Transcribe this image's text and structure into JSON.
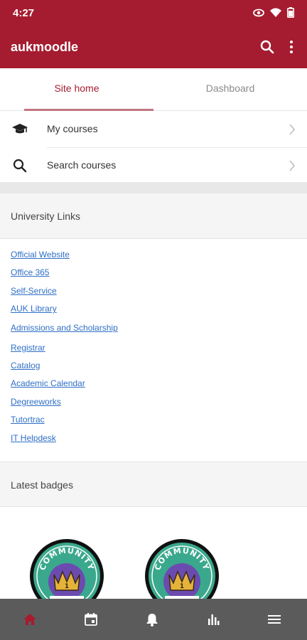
{
  "status": {
    "time": "4:27"
  },
  "app": {
    "title": "aukmoodle"
  },
  "tabs": [
    {
      "label": "Site home",
      "active": true
    },
    {
      "label": "Dashboard",
      "active": false
    }
  ],
  "menu": [
    {
      "label": "My courses",
      "icon": "graduation-cap-icon"
    },
    {
      "label": "Search courses",
      "icon": "search-icon"
    }
  ],
  "university_links": {
    "heading": "University Links",
    "items": [
      "Official Website",
      "Office 365",
      "Self-Service",
      "AUK Library",
      "Admissions and Scholarship",
      "Registrar",
      "Catalog",
      "Academic Calendar",
      "Degreeworks",
      "Tutortrac",
      "IT Helpdesk"
    ]
  },
  "latest_badges": {
    "heading": "Latest badges",
    "badges": [
      {
        "text": "COMMUNITY",
        "number": "1"
      },
      {
        "text": "COMMUNITY",
        "number": "1"
      }
    ]
  },
  "bottom_nav": [
    {
      "icon": "home-icon",
      "active": true
    },
    {
      "icon": "calendar-icon",
      "active": false
    },
    {
      "icon": "bell-icon",
      "active": false
    },
    {
      "icon": "bar-chart-icon",
      "active": false
    },
    {
      "icon": "menu-icon",
      "active": false
    }
  ],
  "colors": {
    "brand": "#a51c30",
    "link": "#2f6fc6",
    "nav_bg": "#5b5b5b",
    "badge_teal": "#3aa88c",
    "badge_purple": "#6c4bb0",
    "crown_gold": "#e4b33a"
  }
}
